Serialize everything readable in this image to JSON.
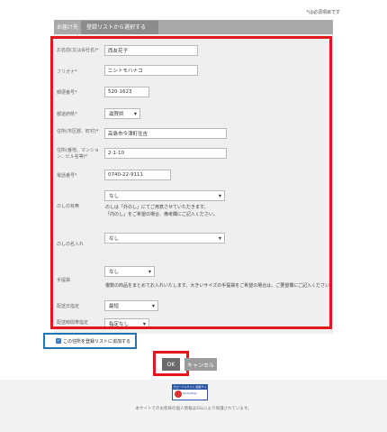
{
  "header": {
    "required_note": "*は必須項目です",
    "tabs": [
      {
        "label": "お届け先"
      },
      {
        "label": "登録リストから選択する"
      }
    ]
  },
  "form": {
    "name": {
      "label": "お名前(又は会社名)",
      "required": "*",
      "value": "西友花子"
    },
    "kana": {
      "label": "フリガナ",
      "required": "*",
      "value": "ニシトモハナコ"
    },
    "postal": {
      "label": "郵便番号",
      "required": "*",
      "value": "520-1623"
    },
    "prefecture": {
      "label": "都道府県",
      "required": "*",
      "value": "滋賀県"
    },
    "city": {
      "label": "住所(市区郡、町村)",
      "required": "*",
      "value": "高島市今津町住吉"
    },
    "address": {
      "label": "住所(番地、マンション、ビル名等)",
      "required": "*",
      "value": "2-1-10"
    },
    "phone": {
      "label": "電話番号",
      "required": "*",
      "value": "0740-22-9111"
    },
    "noshi": {
      "label": "のしの有無",
      "value": "なし",
      "note1": "のしは「外のし」にてご用意させていただきます。",
      "note2": "「内のし」をご希望の場合、備考欄にご記入ください。"
    },
    "noshi_name": {
      "label": "のしの名入れ",
      "value": "なし"
    },
    "bag": {
      "label": "手提袋",
      "value": "なし",
      "note": "複数の商品をまとめてお入れいたします。大きいサイズの手提袋をご希望の場合は、ご要望欄にご記入ください。"
    },
    "delivery": {
      "label": "配送日指定",
      "value": "最短"
    },
    "delivery_time": {
      "label": "配送時間帯指定",
      "value": "指定なし"
    }
  },
  "checkbox": {
    "label": "この住所を登録リストに追加する",
    "checked": true
  },
  "buttons": {
    "ok": "OK",
    "cancel": "キャンセル"
  },
  "footer": {
    "seal_top": "グローバルサイン 認証サイト",
    "seal_text": "GlobalSign",
    "note": "本サイトでのお客様の個人情報はSSLにより保護されています。"
  },
  "colors": {
    "highlight": "#e3171e",
    "checkbox": "#2f7ec6"
  }
}
